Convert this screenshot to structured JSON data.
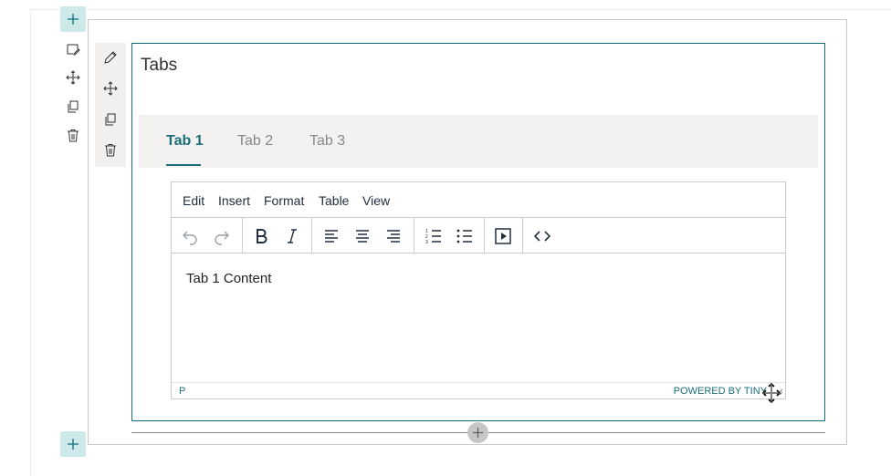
{
  "section": {
    "add_above_icon": "plus-icon",
    "add_below_icon": "plus-icon",
    "tools": [
      "edit-section-icon",
      "move-icon",
      "duplicate-icon",
      "delete-icon"
    ]
  },
  "webpart": {
    "title": "Tabs",
    "tools": [
      "pencil-icon",
      "move-icon",
      "duplicate-icon",
      "delete-icon"
    ],
    "tabs": [
      {
        "label": "Tab 1",
        "active": true
      },
      {
        "label": "Tab 2",
        "active": false
      },
      {
        "label": "Tab 3",
        "active": false
      }
    ]
  },
  "editor": {
    "menu": [
      "Edit",
      "Insert",
      "Format",
      "Table",
      "View"
    ],
    "toolbar": [
      "undo-icon",
      "redo-icon",
      "bold-icon",
      "italic-icon",
      "align-left-icon",
      "align-center-icon",
      "align-right-icon",
      "numbered-list-icon",
      "bullet-list-icon",
      "media-icon",
      "source-code-icon"
    ],
    "content": "Tab 1 Content",
    "path": "P",
    "branding": "POWERED BY TINY"
  },
  "colors": {
    "accent": "#1a6f78",
    "add_button_bg": "#cde9ea",
    "tabbar_bg": "#f3f2f1"
  }
}
